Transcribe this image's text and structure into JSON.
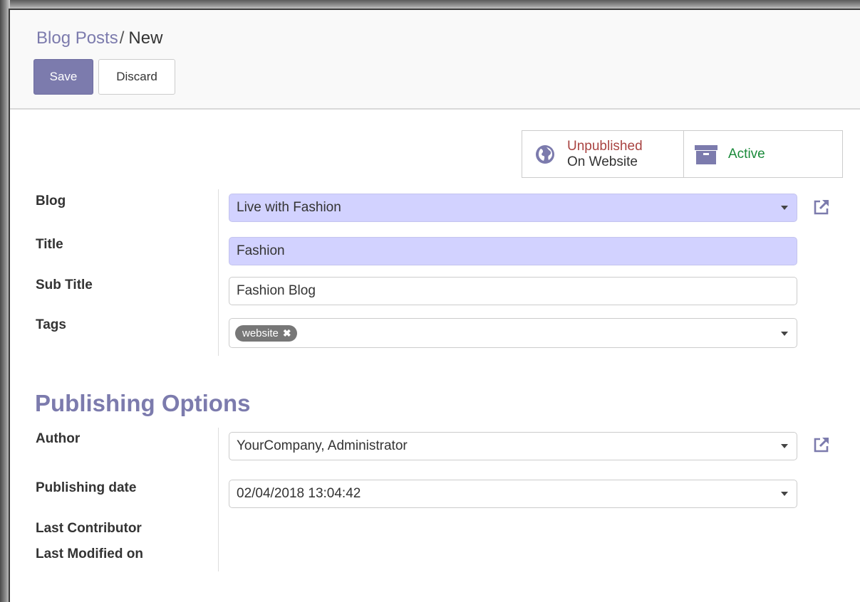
{
  "breadcrumb": {
    "parent": "Blog Posts",
    "separator": "/",
    "current": "New"
  },
  "buttons": {
    "save": "Save",
    "discard": "Discard"
  },
  "button_box": {
    "publish_status": "Unpublished",
    "publish_sub": "On Website",
    "active_label": "Active"
  },
  "form": {
    "blog": {
      "label": "Blog",
      "value": "Live with Fashion"
    },
    "title": {
      "label": "Title",
      "value": "Fashion"
    },
    "subtitle": {
      "label": "Sub Title",
      "value": "Fashion Blog"
    },
    "tags": {
      "label": "Tags",
      "items": [
        "website"
      ]
    }
  },
  "publishing": {
    "section_title": "Publishing Options",
    "author": {
      "label": "Author",
      "value": "YourCompany, Administrator"
    },
    "publishing_date": {
      "label": "Publishing date",
      "value": "02/04/2018 13:04:42"
    },
    "last_contributor": {
      "label": "Last Contributor"
    },
    "last_modified": {
      "label": "Last Modified on"
    }
  },
  "icons": {
    "publish": "globe-icon",
    "active": "archive-icon",
    "external_link": "external-link-icon",
    "tag_remove": "close-icon",
    "dropdown": "caret-down-icon"
  },
  "colors": {
    "brand": "#7c7bad",
    "required_field": "#d2d2ff",
    "unpublished": "#a94442",
    "active": "#1a8a3a",
    "tag_bg": "#777777"
  }
}
